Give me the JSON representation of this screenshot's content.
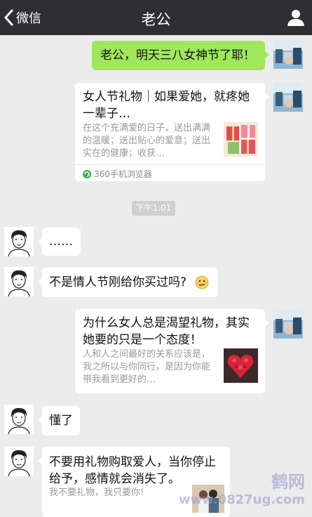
{
  "header": {
    "back_label": "微信",
    "title": "老公"
  },
  "messages": {
    "m1_text": "老公，明天三八女神节了耶！",
    "m2": {
      "title": "女人节礼物｜如果爱她，就疼她一辈子…",
      "desc": "在这个充满爱的日子，送出满满的温暖；送出贴心的爱意；送出实在的健康；收获…",
      "source": "360手机浏览器"
    },
    "timestamp": "下午1:01",
    "m3_text": "……",
    "m4_text": "不是情人节刚给你买过吗?",
    "m5": {
      "title": "为什么女人总是渴望礼物，其实她要的只是一个态度！",
      "desc": "人和人之间最好的关系应该是，我之所以与你同行，是因为你能带我看到更好的…"
    },
    "m6_text": "懂了",
    "m7": {
      "title": "不要用礼物购取爱人，当你停止给予，感情就会消失了。",
      "desc": "我不要礼物，我只要你!"
    }
  },
  "watermark": {
    "main": "鹤网",
    "url": "www.0827ug.com"
  },
  "colors": {
    "titlebar": "#2f2f33",
    "background": "#ececec",
    "green_bubble": "#a0e75a",
    "white_bubble": "#ffffff"
  }
}
